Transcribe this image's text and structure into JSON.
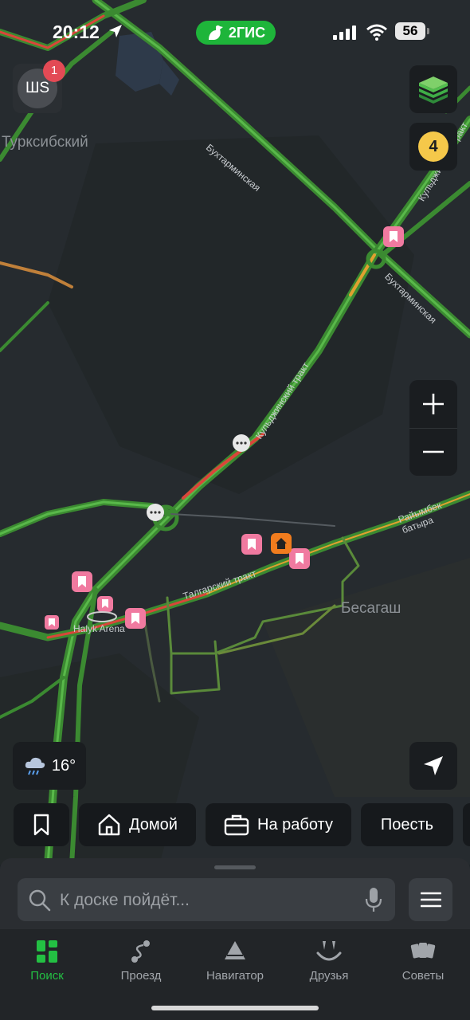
{
  "status_bar": {
    "time": "20:12",
    "app_brand": "2ГИС",
    "battery": "56"
  },
  "profile": {
    "initials": "ШS",
    "notification_count": "1"
  },
  "traffic": {
    "level": "4",
    "color": "#f5c84a"
  },
  "weather": {
    "icon": "rain-cloud-icon",
    "temperature": "16°"
  },
  "map": {
    "district_labels": [
      "Турксибский",
      "Бесагаш"
    ],
    "road_labels": [
      "Бухтарминская",
      "Бухтарминская",
      "Кульджинский тракт",
      "Райымбек батыра",
      "Талгарский тракт",
      "Кульджинский тракт"
    ],
    "poi_labels": [
      "Halyk Arena"
    ]
  },
  "quick_chips": [
    {
      "icon": "bookmark-icon",
      "label": ""
    },
    {
      "icon": "home-icon",
      "label": "Домой"
    },
    {
      "icon": "briefcase-icon",
      "label": "На работу"
    },
    {
      "icon": "",
      "label": "Поесть"
    }
  ],
  "search": {
    "placeholder": "К доске пойдёт..."
  },
  "tabs": [
    {
      "label": "Поиск",
      "active": true
    },
    {
      "label": "Проезд",
      "active": false
    },
    {
      "label": "Навигатор",
      "active": false
    },
    {
      "label": "Друзья",
      "active": false
    },
    {
      "label": "Советы",
      "active": false
    }
  ],
  "colors": {
    "accent": "#1eb53a",
    "road_green": "#4caf3c",
    "road_red": "#d9463a",
    "road_yellow": "#e0a030",
    "bookmark_pink": "#f07aa0",
    "home_orange": "#f07c1e"
  }
}
